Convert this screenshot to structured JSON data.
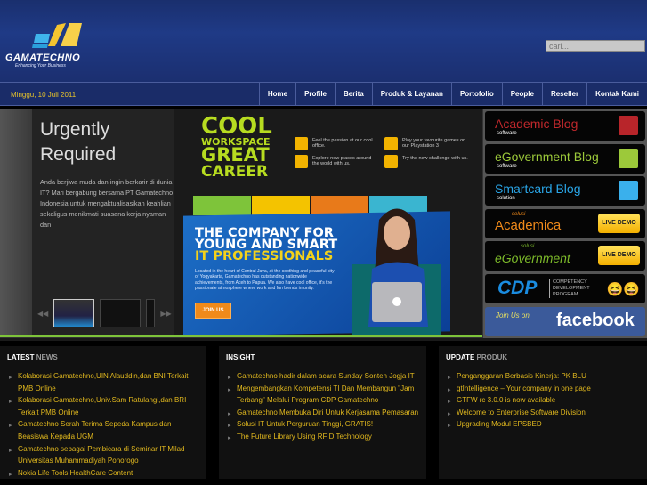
{
  "header": {
    "brand": "GAMATECHNO",
    "tagline": "Enhancing Your Business",
    "search_placeholder": "cari..."
  },
  "nav": {
    "date": "Minggu, 10 Juli 2011",
    "items": [
      "Home",
      "Profile",
      "Berita",
      "Produk & Layanan",
      "Portofolio",
      "People",
      "Reseller",
      "Kontak Kami"
    ]
  },
  "slider": {
    "title": "Urgently Required",
    "text": "Anda berjiwa muda dan ingin berkarir di dunia IT? Mari bergabung bersama PT Gamatechno Indonesia untuk mengaktualisasikan keahlian sekaligus menikmati suasana kerja nyaman dan",
    "poster": {
      "cool": "COOL",
      "workspace": "WORKSPACE",
      "great": "GREAT",
      "career": "CAREER",
      "features": [
        "Feel the passion at our cool office.",
        "Play your favourite games on our Playstation 3",
        "Explore new places around the world with us.",
        "Try the new challenge with us."
      ],
      "headline1": "THE COMPANY FOR",
      "headline2": "YOUNG AND SMART",
      "headline3": "IT PROFESSIONALS",
      "blurb": "Located in the heart of Central Java, at the soothing and peaceful city of Yogyakarta, Gamatechno has outstanding nationwide achievements, from Aceh to Papua. We also have cool office, it's the passionate atmosphere where work and fun blends in unity.",
      "join": "JOIN US"
    }
  },
  "sidebar": [
    {
      "title": "Academic Blog",
      "sub": "software",
      "color": "#c0282c"
    },
    {
      "title": "eGovernment Blog",
      "sub": "software",
      "color": "#9cc93a"
    },
    {
      "title": "Smartcard Blog",
      "sub": "solution",
      "color": "#2aa6e8"
    },
    {
      "pre": "solusi",
      "title": "Academica",
      "demo": "LIVE DEMO",
      "color": "#f08a1a"
    },
    {
      "pre": "solusi",
      "title": "eGovernment",
      "demo": "LIVE DEMO",
      "color": "#7dbb2a"
    },
    {
      "title": "CDP",
      "sub": "COMPETENCY DEVELOPMENT PROGRAM",
      "color": "#1a8ce0"
    },
    {
      "title": "facebook",
      "pre": "Join Us on"
    }
  ],
  "latest": {
    "title1": "LATEST",
    "title2": "NEWS",
    "items": [
      "Kolaborasi Gamatechno,UIN Alauddin,dan BNI Terkait PMB Online",
      "Kolaborasi Gamatechno,Univ.Sam Ratulangi,dan BRI Terkait PMB Online",
      "Gamatechno Serah Terima Sepeda Kampus dan Beasiswa Kepada UGM",
      "Gamatechno sebagai Pembicara di Seminar IT Milad Universitas Muhammadiyah Ponorogo",
      "Nokia Life Tools HealthCare Content"
    ]
  },
  "insight": {
    "title1": "INSIGHT",
    "items": [
      "Gamatechno hadir dalam acara Sunday Sonten Jogja IT",
      "Mengembangkan Kompetensi TI Dan Membangun \"Jam Terbang\" Melalui Program CDP Gamatechno",
      "Gamatechno Membuka Diri Untuk Kerjasama Pemasaran",
      "Solusi IT Untuk Perguruan Tinggi, GRATIS!",
      "The Future Library Using RFID Technology"
    ]
  },
  "update": {
    "title1": "UPDATE",
    "title2": "PRODUK",
    "items": [
      "Penganggaran Berbasis Kinerja: PK BLU",
      "gtIntelligence – Your company in one page",
      "GTFW rc 3.0.0 is now available",
      "Welcome to Enterprise Software Division",
      "Upgrading Modul EPSBED"
    ]
  }
}
